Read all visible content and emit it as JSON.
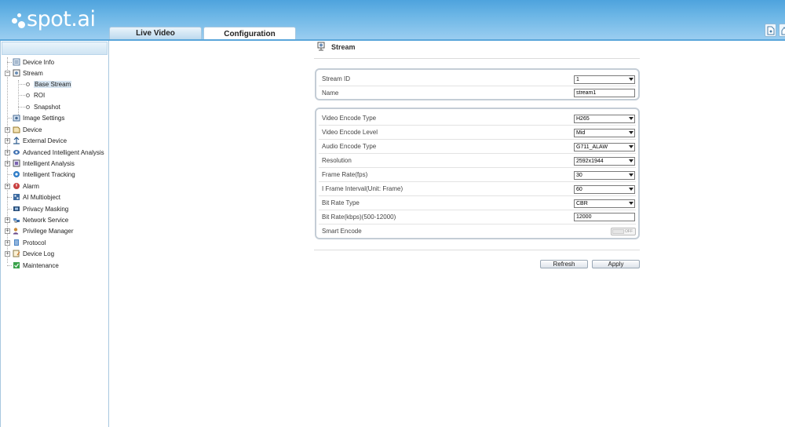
{
  "app": {
    "logo_text": "spot.ai"
  },
  "tabs": [
    {
      "label": "Live Video",
      "active": false
    },
    {
      "label": "Configuration",
      "active": true
    }
  ],
  "sidebar": {
    "items": [
      {
        "label": "Device Info",
        "icon": "device-info-icon",
        "expandable": false
      },
      {
        "label": "Stream",
        "icon": "stream-icon",
        "expandable": true,
        "expanded": true
      },
      {
        "label": "Base Stream",
        "sub": true,
        "selected": true
      },
      {
        "label": "ROI",
        "sub": true
      },
      {
        "label": "Snapshot",
        "sub": true
      },
      {
        "label": "Image Settings",
        "icon": "image-settings-icon",
        "expandable": false
      },
      {
        "label": "Device",
        "icon": "device-icon",
        "expandable": true
      },
      {
        "label": "External Device",
        "icon": "external-device-icon",
        "expandable": true
      },
      {
        "label": "Advanced Intelligent Analysis",
        "icon": "advanced-analysis-icon",
        "expandable": true
      },
      {
        "label": "Intelligent Analysis",
        "icon": "intelligent-analysis-icon",
        "expandable": true
      },
      {
        "label": "Intelligent Tracking",
        "icon": "tracking-icon",
        "expandable": false
      },
      {
        "label": "Alarm",
        "icon": "alarm-icon",
        "expandable": true
      },
      {
        "label": "AI Multiobject",
        "icon": "multiobject-icon",
        "expandable": false
      },
      {
        "label": "Privacy Masking",
        "icon": "privacy-icon",
        "expandable": false
      },
      {
        "label": "Network Service",
        "icon": "network-icon",
        "expandable": true
      },
      {
        "label": "Privilege Manager",
        "icon": "privilege-icon",
        "expandable": true
      },
      {
        "label": "Protocol",
        "icon": "protocol-icon",
        "expandable": true
      },
      {
        "label": "Device Log",
        "icon": "log-icon",
        "expandable": true
      },
      {
        "label": "Maintenance",
        "icon": "maintenance-icon",
        "expandable": false
      }
    ]
  },
  "content": {
    "title": "Stream",
    "panel1": {
      "stream_id": {
        "label": "Stream ID",
        "value": "1"
      },
      "name": {
        "label": "Name",
        "value": "stream1"
      }
    },
    "panel2": {
      "video_encode_type": {
        "label": "Video Encode Type",
        "value": "H265"
      },
      "video_encode_level": {
        "label": "Video Encode Level",
        "value": "Mid"
      },
      "audio_encode_type": {
        "label": "Audio Encode Type",
        "value": "G711_ALAW"
      },
      "resolution": {
        "label": "Resolution",
        "value": "2592x1944"
      },
      "frame_rate": {
        "label": "Frame Rate(fps)",
        "value": "30"
      },
      "i_frame_interval": {
        "label": "I Frame Interval(Unit: Frame)",
        "value": "60"
      },
      "bit_rate_type": {
        "label": "Bit Rate Type",
        "value": "CBR"
      },
      "bit_rate": {
        "label": "Bit Rate(kbps)(500-12000)",
        "value": "12000"
      },
      "smart_encode": {
        "label": "Smart Encode",
        "state": "OFF"
      }
    },
    "buttons": {
      "refresh": "Refresh",
      "apply": "Apply"
    }
  },
  "colors": {
    "header_top": "#4ea3dd",
    "header_bottom": "#9acdf0",
    "panel_border": "#c4cdd6"
  }
}
